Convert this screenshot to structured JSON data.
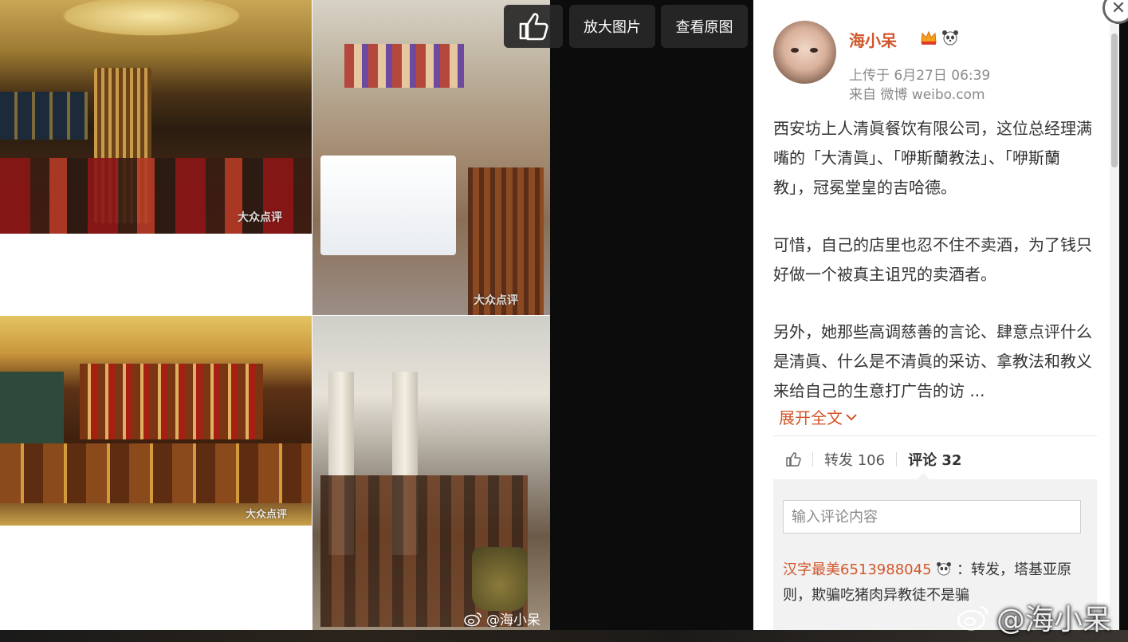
{
  "toolbar": {
    "like_icon": "thumbs-up-icon",
    "zoom_label": "放大图片",
    "original_label": "查看原图"
  },
  "photos": {
    "watermark": "大众点评",
    "weibo_watermark": "@海小呆"
  },
  "user": {
    "name": "海小呆",
    "upload_time": "上传于 6月27日 06:39",
    "source": "来自 微博 weibo.com"
  },
  "post": {
    "paragraphs": [
      "西安坊上人清眞餐饮有限公司，这位总经理满嘴的「大清眞」、「咿斯蘭教法」、「咿斯蘭教」，冠冕堂皇的吉哈德。",
      "可惜，自己的店里也忍不住不卖酒，为了钱只好做一个被真主诅咒的卖酒者。",
      "另外，她那些高调慈善的言论、肆意点评什么是清眞、什么是不清眞的采访、拿教法和教义来给自己的生意打广告的访 ..."
    ],
    "expand_label": "展开全文"
  },
  "actions": {
    "repost_label": "转发 106",
    "comment_label": "评论 32"
  },
  "comments": {
    "input_placeholder": "输入评论内容",
    "first": {
      "user": "汉字最美6513988045",
      "text": "：转发，塔基亚原则，欺骗吃猪肉异教徒不是骗"
    }
  },
  "overlay_watermark": "@海小呆",
  "colors": {
    "accent": "#d1572b",
    "panel_bg": "#ffffff",
    "viewer_bg": "#0c0c0c"
  }
}
